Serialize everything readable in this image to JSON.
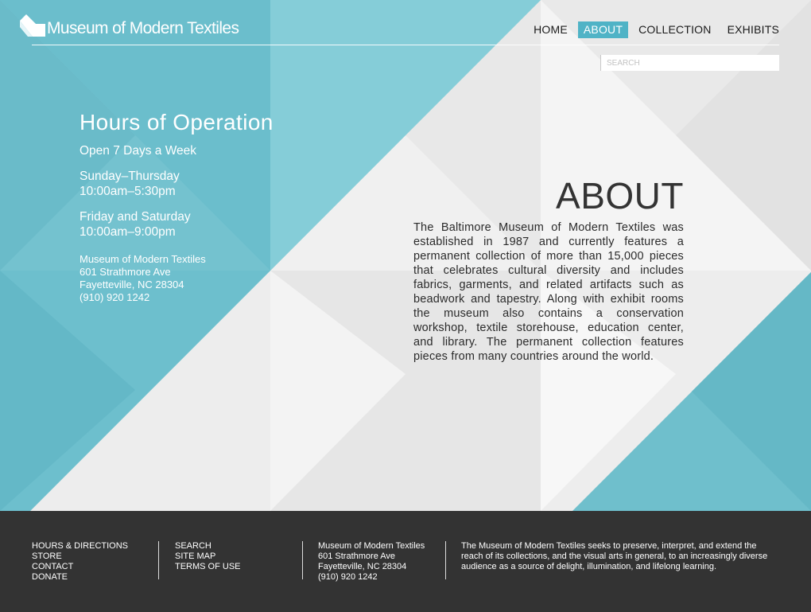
{
  "brand": {
    "name": "Museum of Modern Textiles"
  },
  "nav": [
    {
      "label": "HOME",
      "active": false
    },
    {
      "label": "ABOUT",
      "active": true
    },
    {
      "label": "COLLECTION",
      "active": false
    },
    {
      "label": "EXHIBITS",
      "active": false
    }
  ],
  "search": {
    "placeholder": "SEARCH",
    "value": ""
  },
  "hours": {
    "title": "Hours of Operation",
    "subtitle": "Open 7 Days a Week",
    "weekday_days": "Sunday–Thursday",
    "weekday_time": "10:00am–5:30pm",
    "weekend_days": "Friday and Saturday",
    "weekend_time": "10:00am–9:00pm",
    "address": {
      "name": "Museum of Modern Textiles",
      "street": "601 Strathmore Ave",
      "city": "Fayetteville, NC 28304",
      "phone": "(910) 920 1242"
    }
  },
  "about": {
    "title": "ABOUT",
    "body": "The Baltimore Museum of Modern Textiles was established in 1987 and currently features a permanent collection of more than 15,000 pieces that celebrates cultural diversity and includes fabrics, garments, and related artifacts such as beadwork and tapestry. Along with exhibit rooms the museum also contains a conservation workshop, textile storehouse, education center, and library. The permanent collection features pieces from many countries around the world."
  },
  "footer": {
    "col1": [
      "HOURS & DIRECTIONS",
      "STORE",
      "CONTACT",
      "DONATE"
    ],
    "col2": [
      "SEARCH",
      "SITE MAP",
      "TERMS OF USE"
    ],
    "col3": [
      "Museum of Modern Textiles",
      "601 Strathmore Ave",
      "Fayetteville, NC 28304",
      "(910) 920 1242"
    ],
    "mission": "The Museum of Modern Textiles seeks to preserve, interpret, and extend the reach of its collections, and the visual arts in general, to an increasingly diverse audience as a source of delight, illumination, and lifelong learning."
  },
  "colors": {
    "accent": "#4fb3c6",
    "teal_light": "#7ac7d4",
    "teal_dark": "#63b6c5",
    "footer_bg": "#333333"
  }
}
